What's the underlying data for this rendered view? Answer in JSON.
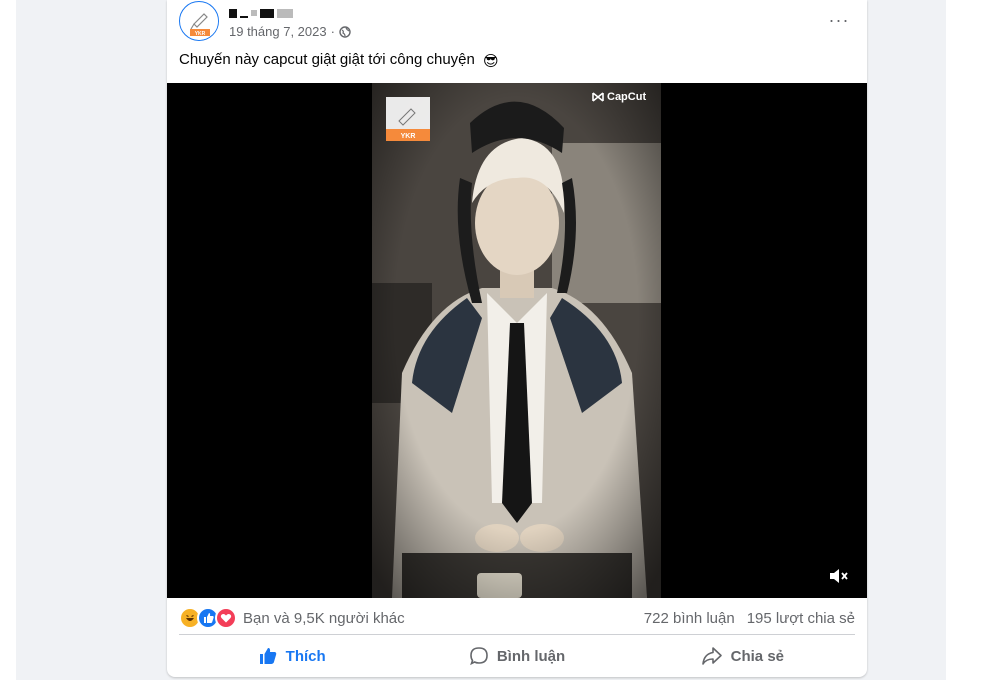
{
  "post": {
    "date": "19 tháng 7, 2023",
    "separator": "·",
    "caption": "Chuyến này capcut giật giật tới công chuyện",
    "caption_emoji": "😎",
    "more_label": "···",
    "avatar_badge": "YKR"
  },
  "video": {
    "watermark_badge": "YKR",
    "capcut_label": "CapCut"
  },
  "reactions": {
    "summary": "Bạn và 9,5K người khác",
    "comments": "722 bình luận",
    "shares": "195 lượt chia sẻ",
    "icons": [
      "haha-icon",
      "like-icon",
      "love-icon"
    ]
  },
  "actions": {
    "like": "Thích",
    "comment": "Bình luận",
    "share": "Chia sẻ"
  },
  "colors": {
    "accent": "#1877f2",
    "secondary_text": "#65676b",
    "badge_orange": "#f58a3b"
  }
}
